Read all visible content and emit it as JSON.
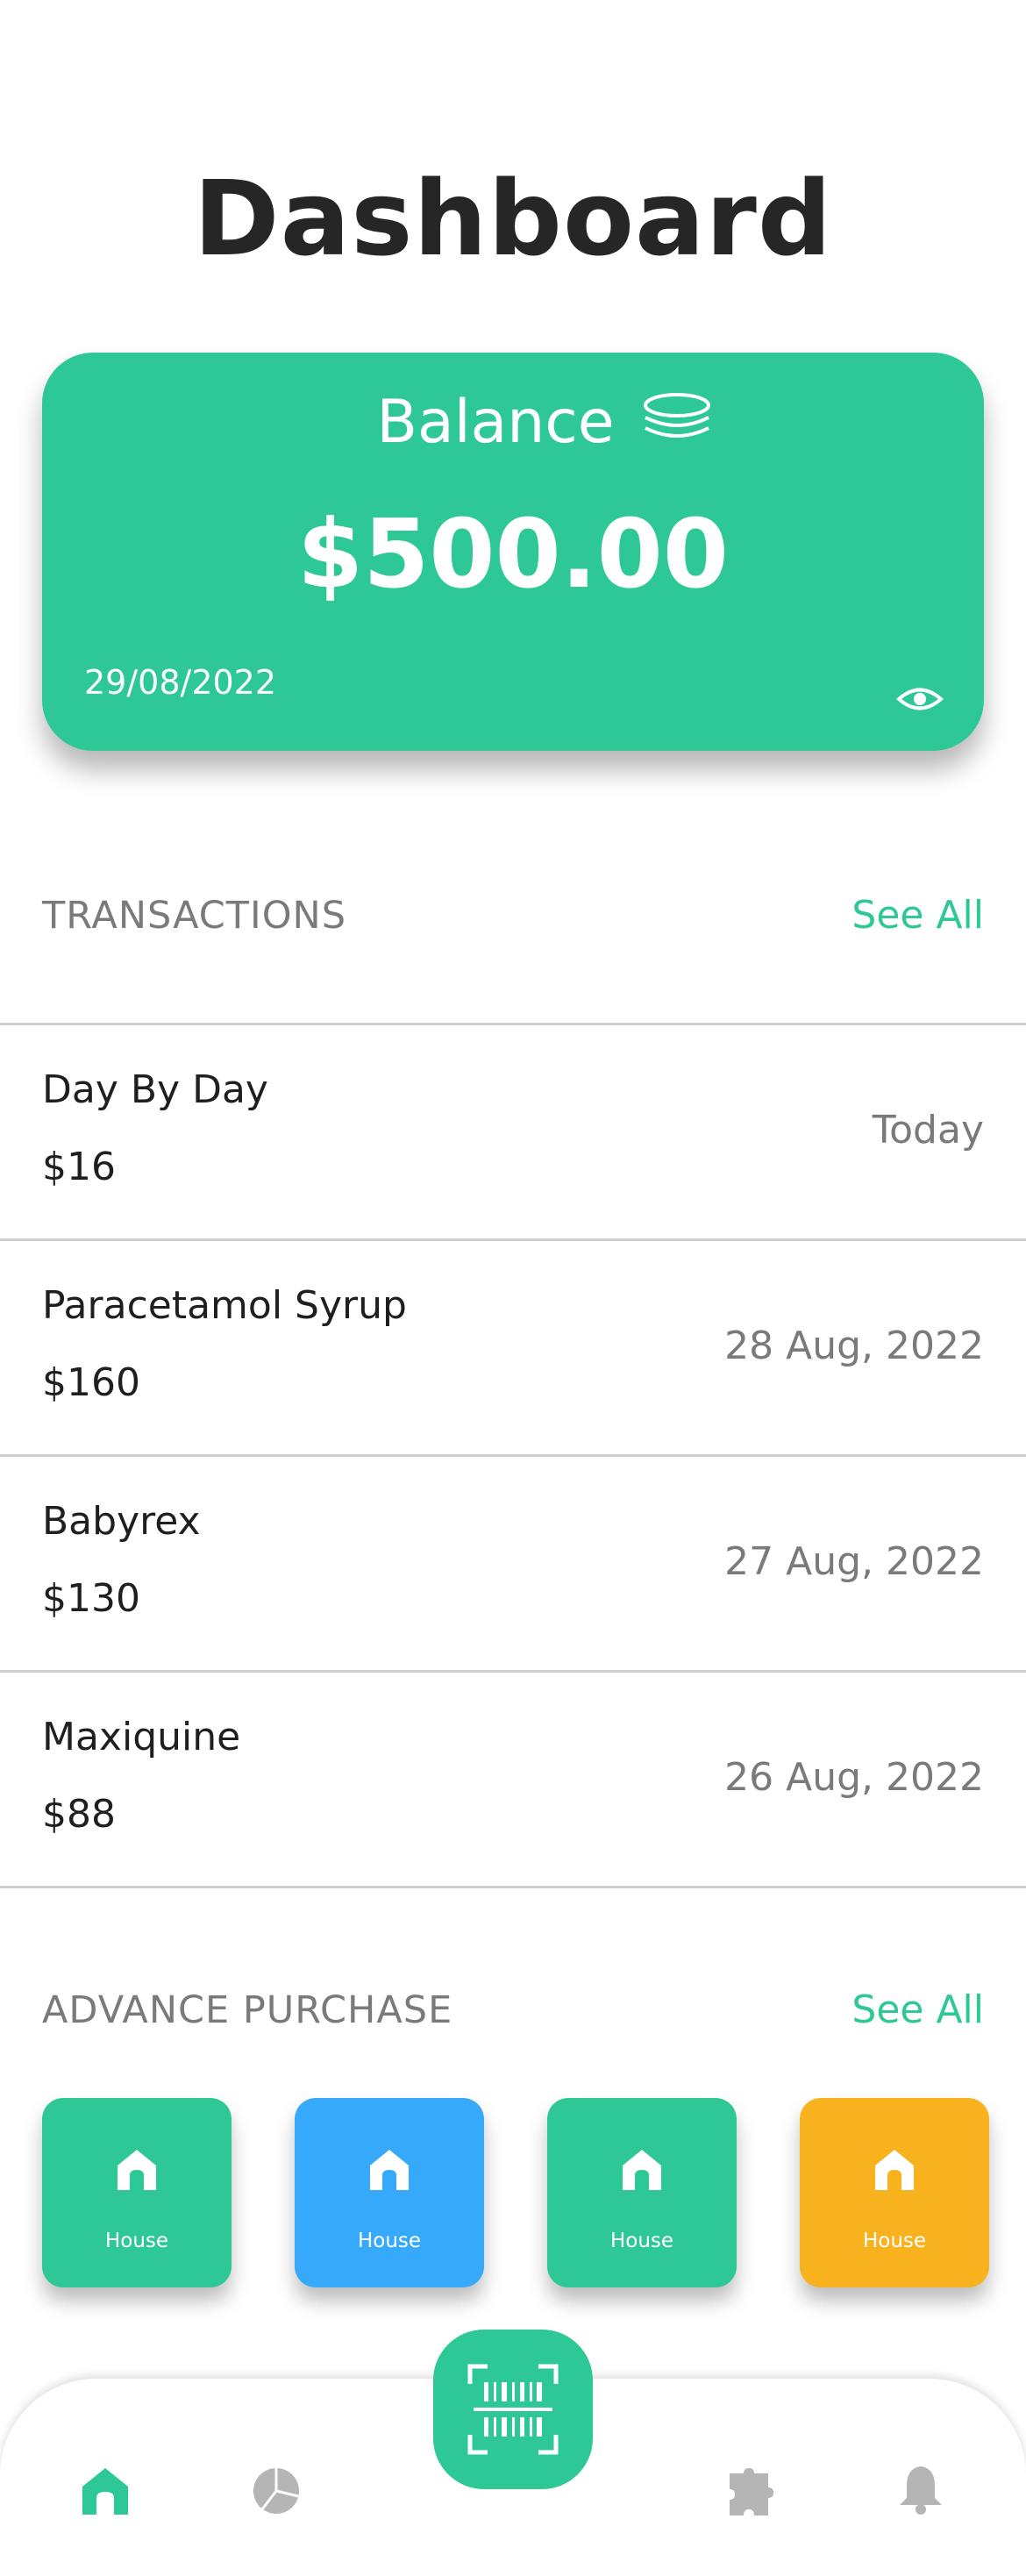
{
  "header": {
    "title": "Dashboard"
  },
  "balance": {
    "title": "Balance",
    "amount": "$500.00",
    "date": "29/08/2022",
    "coins_icon": "coins-icon",
    "visibility_icon": "eye-icon"
  },
  "transactions": {
    "section_title": "TRANSACTIONS",
    "see_all": "See All",
    "items": [
      {
        "name": "Day By Day",
        "amount": "$16",
        "date": "Today"
      },
      {
        "name": "Paracetamol Syrup",
        "amount": "$160",
        "date": "28 Aug, 2022"
      },
      {
        "name": "Babyrex",
        "amount": "$130",
        "date": "27 Aug, 2022"
      },
      {
        "name": "Maxiquine",
        "amount": "$88",
        "date": "26 Aug, 2022"
      }
    ]
  },
  "advance_purchase": {
    "section_title": "ADVANCE PURCHASE",
    "see_all": "See All",
    "tiles": [
      {
        "label": "House",
        "color": "#2ec897",
        "icon": "home-icon"
      },
      {
        "label": "House",
        "color": "#37a9fb",
        "icon": "home-icon"
      },
      {
        "label": "House",
        "color": "#2ec897",
        "icon": "home-icon"
      },
      {
        "label": "House",
        "color": "#f8b21d",
        "icon": "home-icon"
      }
    ]
  },
  "bottom_nav": {
    "items": [
      "home-icon",
      "pie-chart-icon",
      "barcode-scan-icon",
      "puzzle-icon",
      "bell-icon"
    ],
    "active": "home-icon"
  },
  "colors": {
    "accent": "#2ec897",
    "blue": "#37a9fb",
    "orange": "#f8b21d",
    "muted_text": "#7a7a7a",
    "inactive_icon": "#b5b5b5"
  }
}
